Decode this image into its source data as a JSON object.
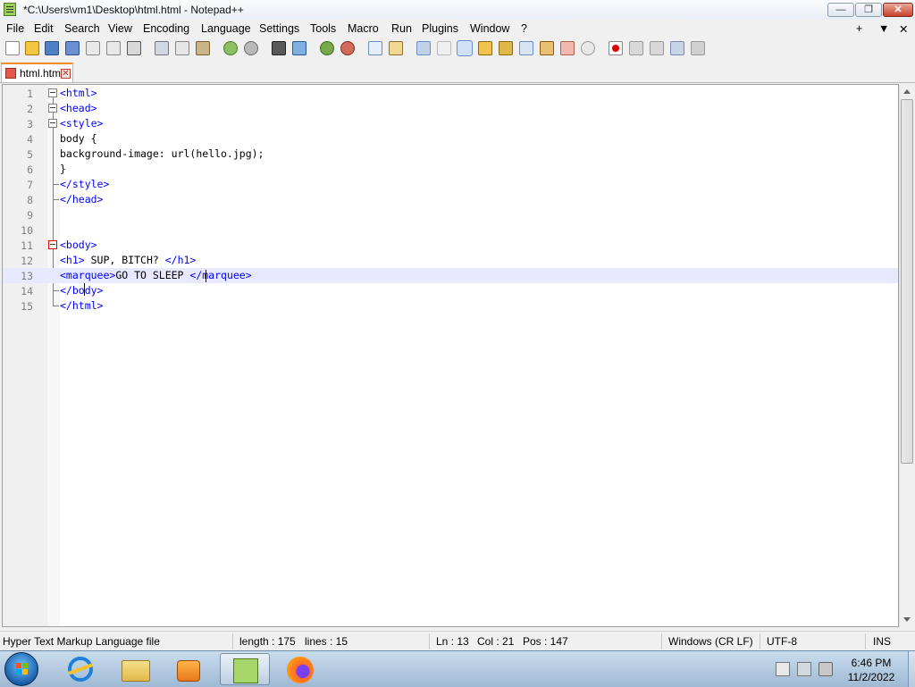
{
  "window": {
    "title": "*C:\\Users\\vm1\\Desktop\\html.html - Notepad++",
    "minimize_label": "—",
    "maximize_label": "❐",
    "close_label": "✕"
  },
  "menu": {
    "items": [
      "File",
      "Edit",
      "Search",
      "View",
      "Encoding",
      "Language",
      "Settings",
      "Tools",
      "Macro",
      "Run",
      "Plugins",
      "Window",
      "?"
    ],
    "right_controls": [
      "+",
      "▼",
      "✕"
    ]
  },
  "tabs": [
    {
      "label": "html.html",
      "close": "✕"
    }
  ],
  "editor": {
    "current_line": 13,
    "lines": [
      {
        "num": "1",
        "text": "<html>"
      },
      {
        "num": "2",
        "text": "<head>"
      },
      {
        "num": "3",
        "text": "<style>"
      },
      {
        "num": "4",
        "text": "body {"
      },
      {
        "num": "5",
        "text": "background-image: url(hello.jpg);"
      },
      {
        "num": "6",
        "text": "}"
      },
      {
        "num": "7",
        "text": "</style>"
      },
      {
        "num": "8",
        "text": "</head>"
      },
      {
        "num": "9",
        "text": ""
      },
      {
        "num": "10",
        "text": ""
      },
      {
        "num": "11",
        "text": "<body>"
      },
      {
        "num": "12",
        "text": "<h1> SUP, BITCH? </h1>"
      },
      {
        "num": "13",
        "text": "<marquee>GO TO SLEEP </marquee>"
      },
      {
        "num": "14",
        "text": "</body>"
      },
      {
        "num": "15",
        "text": "</html>"
      }
    ]
  },
  "status": {
    "file_type": "Hyper Text Markup Language file",
    "length": "length : 175",
    "lines": "lines : 15",
    "ln": "Ln : 13",
    "col": "Col : 21",
    "pos": "Pos : 147",
    "eol": "Windows (CR LF)",
    "encoding": "UTF-8",
    "mode": "INS"
  },
  "taskbar": {
    "apps": [
      "internet-explorer",
      "file-explorer",
      "media-player",
      "notepad-plus-plus",
      "firefox"
    ],
    "clock_time": "6:46 PM",
    "clock_date": "11/2/2022"
  },
  "colors": {
    "tag_blue": "#0000ff",
    "tab_accent": "#ff8c26",
    "current_line": "#e8e8ff"
  }
}
